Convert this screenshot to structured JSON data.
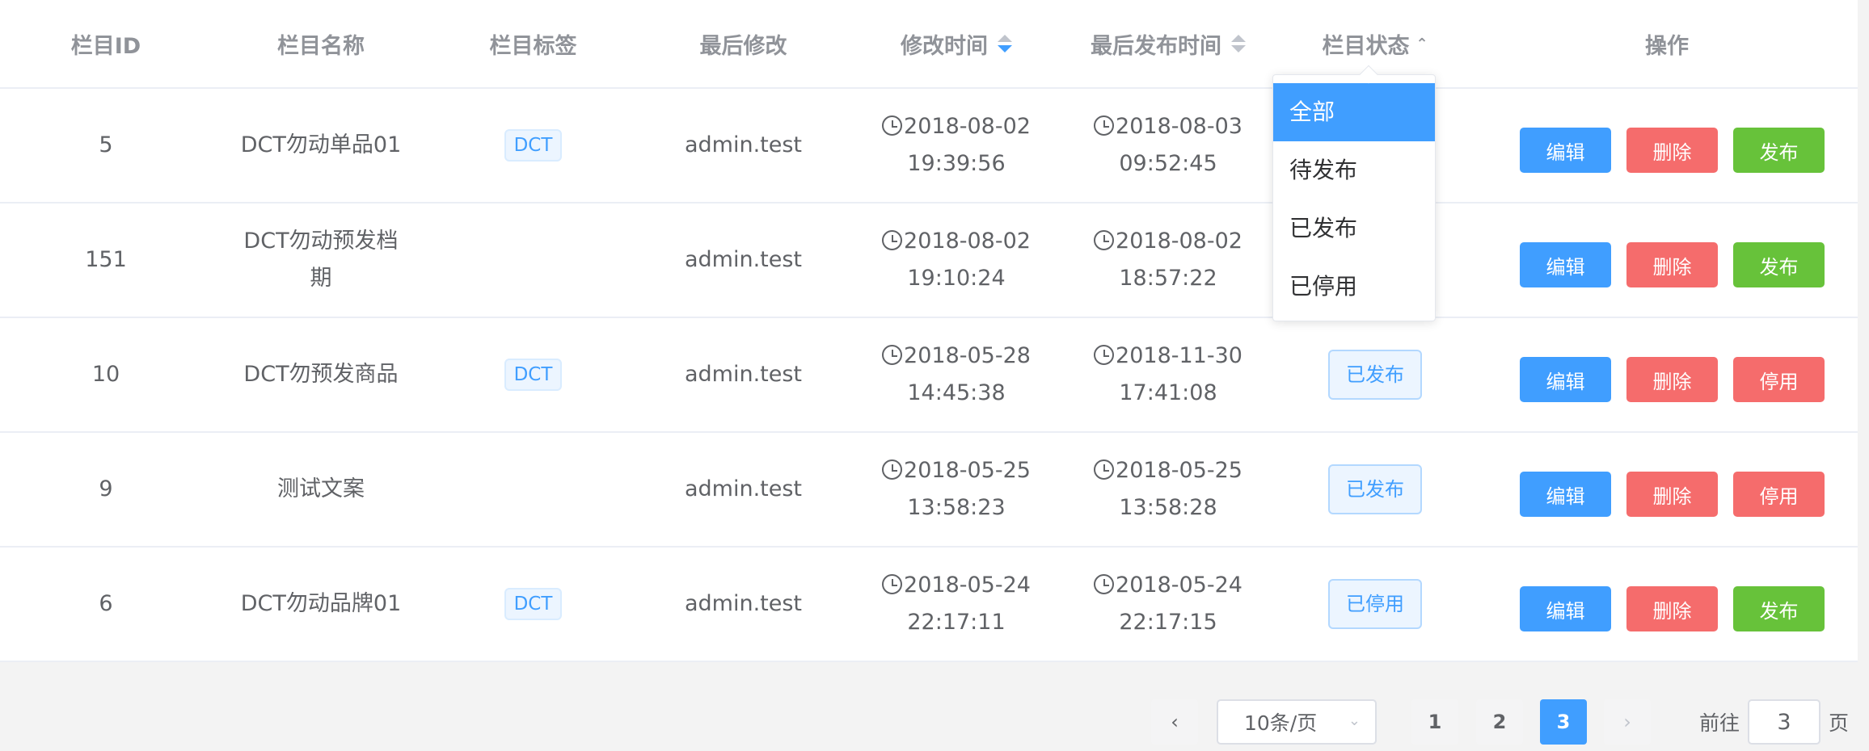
{
  "columns": {
    "id": "栏目ID",
    "name": "栏目名称",
    "tag": "栏目标签",
    "last_modifier": "最后修改",
    "modified_time": "修改时间",
    "published_time": "最后发布时间",
    "status": "栏目状态",
    "actions": "操作"
  },
  "rows": [
    {
      "id": "5",
      "name": "DCT勿动单品01",
      "tag": "DCT",
      "last_modifier": "admin.test",
      "modified_time": "2018-08-02 19:39:56",
      "published_time": "2018-08-03 09:52:45",
      "status": "",
      "toggle": "发布"
    },
    {
      "id": "151",
      "name": "DCT勿动预发档期",
      "tag": "",
      "last_modifier": "admin.test",
      "modified_time": "2018-08-02 19:10:24",
      "published_time": "2018-08-02 18:57:22",
      "status": "",
      "toggle": "发布"
    },
    {
      "id": "10",
      "name": "DCT勿预发商品",
      "tag": "DCT",
      "last_modifier": "admin.test",
      "modified_time": "2018-05-28 14:45:38",
      "published_time": "2018-11-30 17:41:08",
      "status": "已发布",
      "toggle": "停用"
    },
    {
      "id": "9",
      "name": "测试文案",
      "tag": "",
      "last_modifier": "admin.test",
      "modified_time": "2018-05-25 13:58:23",
      "published_time": "2018-05-25 13:58:28",
      "status": "已发布",
      "toggle": "停用"
    },
    {
      "id": "6",
      "name": "DCT勿动品牌01",
      "tag": "DCT",
      "last_modifier": "admin.test",
      "modified_time": "2018-05-24 22:17:11",
      "published_time": "2018-05-24 22:17:15",
      "status": "已停用",
      "toggle": "发布"
    }
  ],
  "actions": {
    "edit": "编辑",
    "delete": "删除"
  },
  "status_filter": {
    "options": [
      "全部",
      "待发布",
      "已发布",
      "已停用"
    ],
    "selected": "全部"
  },
  "pagination": {
    "page_size": "10条/页",
    "pages": [
      "1",
      "2",
      "3"
    ],
    "current_page": "3",
    "goto_prefix": "前往",
    "goto_value": "3",
    "goto_suffix": "页"
  },
  "colors": {
    "primary": "#409eff",
    "danger": "#f56c6c",
    "success": "#67c23a"
  }
}
